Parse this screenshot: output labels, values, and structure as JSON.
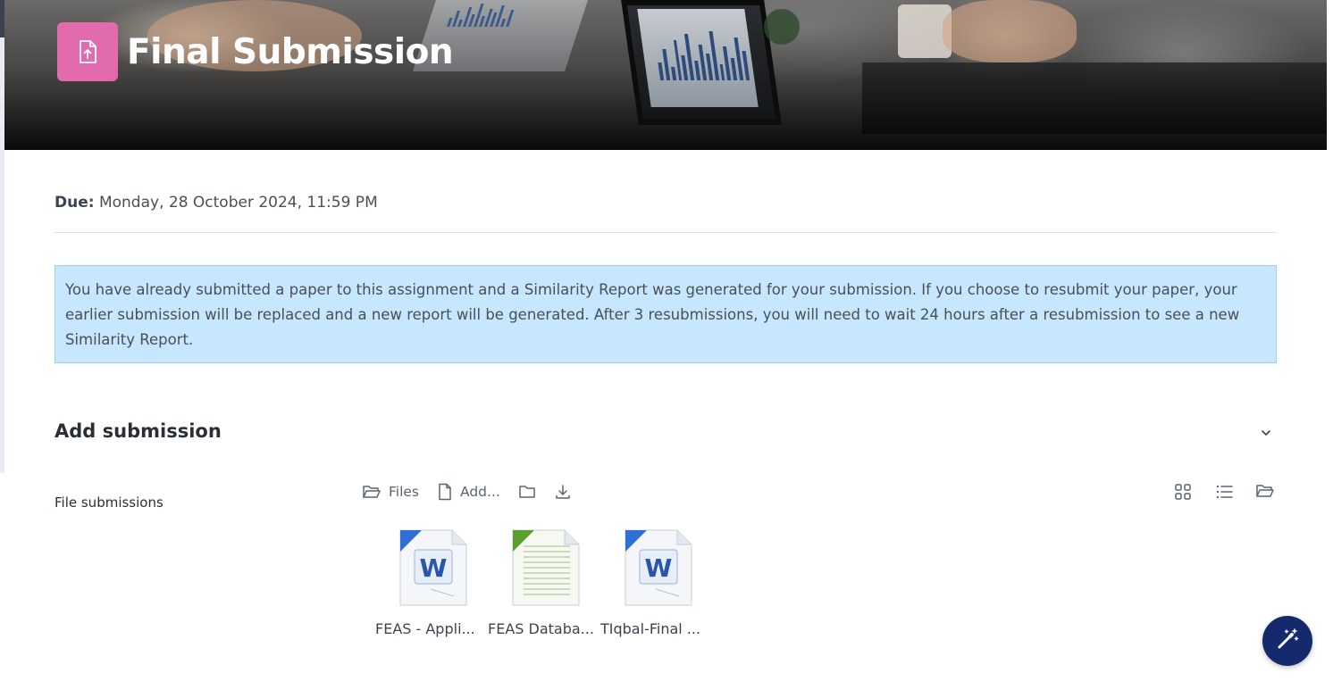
{
  "header": {
    "title": "Final Submission",
    "icon": "assignment-upload-icon",
    "icon_bg": "#e26bad"
  },
  "due": {
    "label": "Due:",
    "value": "Monday, 28 October 2024, 11:59 PM"
  },
  "alert": {
    "text": "You have already submitted a paper to this assignment and a Similarity Report was generated for your submission. If you choose to resubmit your paper, your earlier submission will be replaced and a new report will be generated. After 3 resubmissions, you will need to wait 24 hours after a resubmission to see a new Similarity Report.",
    "bg": "#c6e7fd"
  },
  "section": {
    "title": "Add submission"
  },
  "file_submissions": {
    "label": "File submissions",
    "toolbar": {
      "files_label": "Files",
      "add_label": "Add..."
    },
    "files": [
      {
        "name": "FEAS - Appli...",
        "type": "word"
      },
      {
        "name": "FEAS Databa...",
        "type": "text"
      },
      {
        "name": "TIqbal-Final ...",
        "type": "word"
      }
    ]
  },
  "colors": {
    "fab": "#142a6c",
    "text": "#3d4451"
  }
}
